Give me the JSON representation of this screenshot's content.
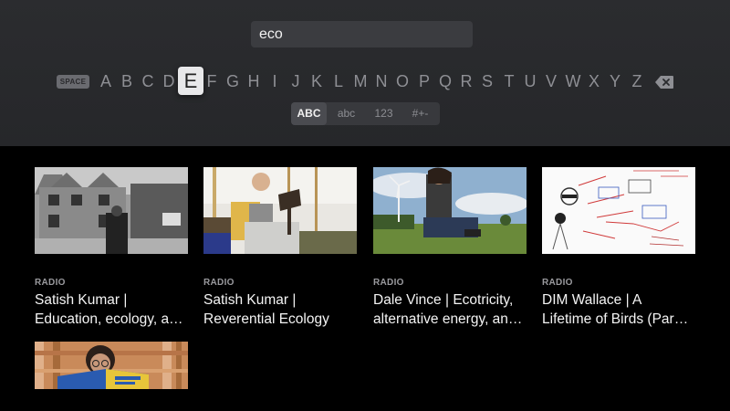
{
  "search": {
    "query": "eco"
  },
  "keyboard": {
    "space_label": "SPACE",
    "letters": [
      "A",
      "B",
      "C",
      "D",
      "E",
      "F",
      "G",
      "H",
      "I",
      "J",
      "K",
      "L",
      "M",
      "N",
      "O",
      "P",
      "Q",
      "R",
      "S",
      "T",
      "U",
      "V",
      "W",
      "X",
      "Y",
      "Z"
    ],
    "focused_letter": "E",
    "backspace_icon": "backspace-icon",
    "modes": [
      "ABC",
      "abc",
      "123",
      "#+-"
    ],
    "active_mode": "ABC"
  },
  "results": [
    {
      "kind": "RADIO",
      "title_line1": "Satish Kumar |",
      "title_line2": "Education, ecology, a…",
      "thumb": "manor-house-photo"
    },
    {
      "kind": "RADIO",
      "title_line1": "Satish Kumar |",
      "title_line2": "Reverential Ecology",
      "thumb": "man-at-lectern-photo"
    },
    {
      "kind": "RADIO",
      "title_line1": "Dale Vince | Ecotricity,",
      "title_line2": "alternative energy, an…",
      "thumb": "man-wind-turbine-photo"
    },
    {
      "kind": "RADIO",
      "title_line1": "DIM Wallace | A",
      "title_line2": "Lifetime of Birds (Par…",
      "thumb": "sketch-diagram-photo"
    },
    {
      "kind": "",
      "title_line1": "",
      "title_line2": "",
      "thumb": "woman-reading-book-photo"
    }
  ]
}
